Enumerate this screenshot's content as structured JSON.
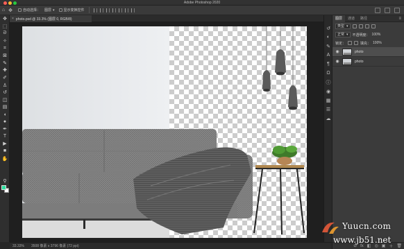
{
  "window": {
    "title": "Adobe Photoshop 2020",
    "traffic_colors": [
      "#ff5f57",
      "#febc2e",
      "#28c840"
    ]
  },
  "options_bar": {
    "auto_select_label": "自动选择：",
    "auto_select_value": "图层",
    "show_transform_label": "显示变换控件"
  },
  "document_tab": {
    "label": "photo.psd @ 33.3% (图层 0, RGB/8)",
    "close_glyph": "×"
  },
  "status_bar": {
    "zoom": "33.33%",
    "doc_info": "3508 像素 x 3796 像素 (72 ppi)"
  },
  "tools": [
    "move-icon",
    "marquee-icon",
    "lasso-icon",
    "magic-wand-icon",
    "crop-icon",
    "frame-icon",
    "eyedropper-icon",
    "healing-icon",
    "brush-icon",
    "stamp-icon",
    "history-brush-icon",
    "eraser-icon",
    "gradient-icon",
    "blur-icon",
    "dodge-icon",
    "pen-icon",
    "type-icon",
    "path-select-icon",
    "shape-icon",
    "hand-icon",
    "zoom-icon",
    "more-tools-icon"
  ],
  "tool_glyphs": [
    "✥",
    "⬚",
    "ᘐ",
    "✧",
    "⌗",
    "⊠",
    "✎",
    "✚",
    "✐",
    "♙",
    "↺",
    "◫",
    "▤",
    "◖",
    "●",
    "✒",
    "T",
    "▶",
    "■",
    "✋",
    "⚲",
    "⋯"
  ],
  "colors": {
    "foreground": "#2fe0a0",
    "background": "#ffffff"
  },
  "right_strip_icons": [
    "history-icon",
    "adjust-icon",
    "brush-settings-icon",
    "char-icon",
    "paragraph-icon",
    "glyph-icon",
    "info-icon",
    "color-icon",
    "swatches-icon",
    "properties-icon",
    "libraries-icon"
  ],
  "right_strip_glyphs": [
    "↺",
    "◐",
    "✎",
    "A",
    "¶",
    "Ω",
    "ⓘ",
    "◉",
    "▦",
    "☰",
    "☁"
  ],
  "panel": {
    "tabs": [
      "图层",
      "通道",
      "路径"
    ],
    "menu_glyph": "≡",
    "kind_label": "类型",
    "blend_mode": "正常",
    "opacity_label": "不透明度：",
    "opacity_value": "100%",
    "lock_label": "锁定：",
    "fill_label": "填充：",
    "fill_value": "100%",
    "layers": [
      {
        "name": "photo",
        "selected": true
      },
      {
        "name": "photo",
        "selected": false
      }
    ],
    "eye_glyph": "◉",
    "footer_glyphs": [
      "⊘",
      "fx",
      "◧",
      "◎",
      "▣",
      "＋",
      "🗑"
    ]
  },
  "watermark": {
    "line1": "Yuucn.com",
    "line2": "www.jb51.net"
  }
}
